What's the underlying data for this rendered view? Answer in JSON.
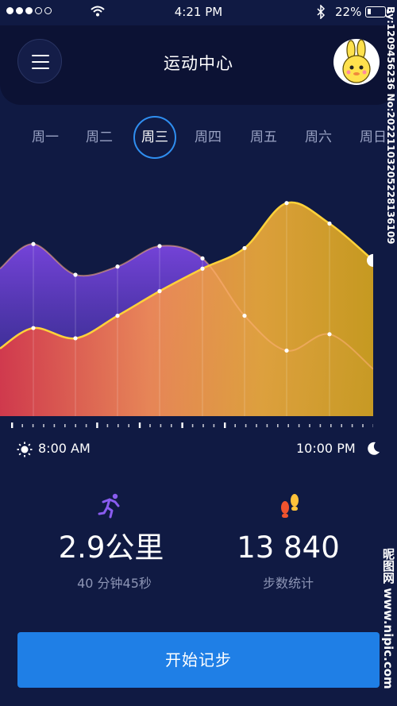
{
  "status_bar": {
    "time": "4:21 PM",
    "battery": "22%",
    "battery_level": 0.22,
    "signal_dots_filled": 3,
    "signal_dots_total": 5
  },
  "header": {
    "title": "运动中心"
  },
  "days": {
    "items": [
      "周一",
      "周二",
      "周三",
      "周四",
      "周五",
      "周六",
      "周日"
    ],
    "selected": "周三"
  },
  "chart_data": {
    "type": "area",
    "series": [
      {
        "color": "#6b3fd6",
        "values": [
          7.2,
          8.4,
          6.9,
          7.3,
          8.3,
          7.7,
          4.9,
          3.2,
          4.0,
          2.3
        ]
      },
      {
        "color": "#ffd23a",
        "values": [
          3.3,
          4.3,
          3.8,
          4.9,
          6.1,
          7.2,
          8.2,
          10.4,
          9.4,
          7.6
        ]
      }
    ],
    "x_start": "8:00 AM",
    "x_end": "10:00 PM"
  },
  "time_axis": {
    "start": "8:00 AM",
    "end": "10:00 PM"
  },
  "stats": {
    "distance": {
      "value": "2.9公里",
      "label": "40 分钟45秒",
      "icon": "running-icon"
    },
    "steps": {
      "value": "13 840",
      "label": "步数统计",
      "icon": "footprints-icon"
    }
  },
  "actions": {
    "start_label": "开始记步"
  },
  "watermark": {
    "id_text": "By:1209456236 No:20221103205228136109",
    "site": "昵图网 www.nipic.com"
  }
}
